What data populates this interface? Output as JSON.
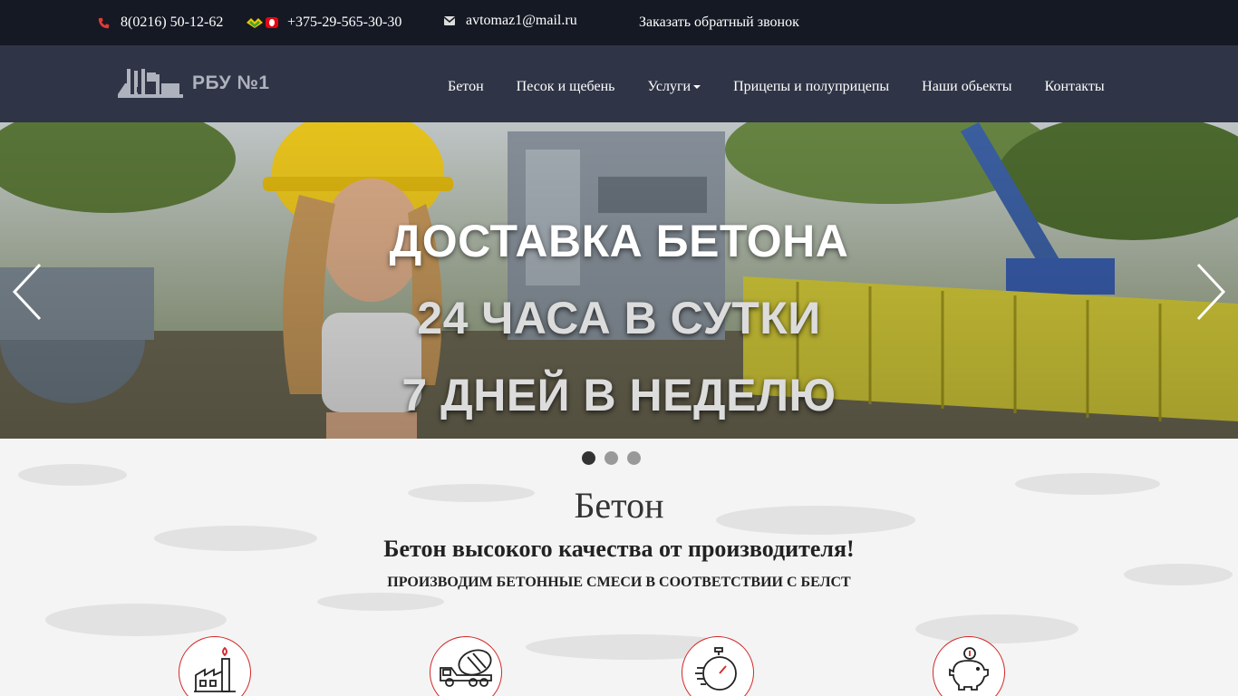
{
  "topbar": {
    "phone_landline": "8(0216) 50-12-62",
    "phone_mobile": "+375-29-565-30-30",
    "email": "avtomaz1@mail.ru",
    "callback_label": "Заказать обратный звонок"
  },
  "header": {
    "logo_text": "РБУ №1",
    "nav": [
      {
        "label": "Бетон"
      },
      {
        "label": "Песок и щебень"
      },
      {
        "label": "Услуги",
        "has_dropdown": true
      },
      {
        "label": "Прицепы и полуприцепы"
      },
      {
        "label": "Наши обьекты"
      },
      {
        "label": "Контакты"
      }
    ]
  },
  "slider": {
    "lines": [
      "ДОСТАВКА БЕТОНА",
      "24 ЧАСА В СУТКИ",
      "7 ДНЕЙ В НЕДЕЛЮ"
    ],
    "slide_count": 3,
    "active_slide": 1
  },
  "section": {
    "title": "Бетон",
    "subtitle": "Бетон высокого качества от производителя!",
    "tagline": "ПРОИЗВОДИМ БЕТОННЫЕ СМЕСИ В СООТВЕТСТВИИ С БЕЛСТ"
  },
  "features": [
    {
      "icon": "factory-icon"
    },
    {
      "icon": "concrete-mixer-truck-icon"
    },
    {
      "icon": "stopwatch-icon"
    },
    {
      "icon": "piggy-bank-icon"
    }
  ],
  "colors": {
    "topbar_bg": "#151924",
    "navbar_bg": "#2f3446",
    "accent_red": "#d42727",
    "phone_icon_red": "#e53935"
  }
}
